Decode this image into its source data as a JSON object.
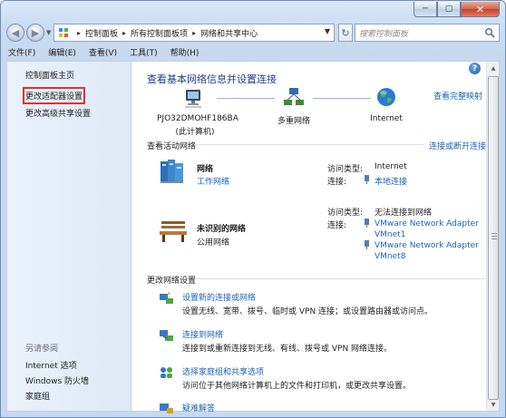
{
  "window": {
    "caption": {
      "minimize": "─",
      "maximize": "▢",
      "close": "✕"
    }
  },
  "nav": {
    "back": "◀",
    "forward": "▶",
    "breadcrumbs": [
      "控制面板",
      "所有控制面板项",
      "网络和共享中心"
    ],
    "search_placeholder": "搜索控制面板"
  },
  "menu": [
    "文件(F)",
    "编辑(E)",
    "查看(V)",
    "工具(T)",
    "帮助(H)"
  ],
  "sidebar": {
    "items": [
      "控制面板主页",
      "更改适配器设置",
      "更改高级共享设置"
    ],
    "see_also_heading": "另请参阅",
    "see_also": [
      "Internet 选项",
      "Windows 防火墙",
      "家庭组"
    ]
  },
  "main": {
    "title": "查看基本网络信息并设置连接",
    "full_map_link": "查看完整映射",
    "map": {
      "computer_name": "PJO32DMOHF186BA",
      "computer_sub": "(此计算机)",
      "middle": "多重网络",
      "internet": "Internet"
    },
    "active_heading": "查看活动网络",
    "connect_link": "连接或断开连接",
    "networks": [
      {
        "name": "网络",
        "type": "工作网络",
        "access_label": "访问类型:",
        "access_value": "Internet",
        "conn_label": "连接:",
        "conn_values": [
          "本地连接"
        ]
      },
      {
        "name": "未识别的网络",
        "type": "公用网络",
        "access_label": "访问类型:",
        "access_value": "无法连接到网络",
        "conn_label": "连接:",
        "conn_values": [
          "VMware Network Adapter VMnet1",
          "VMware Network Adapter VMnet8"
        ]
      }
    ],
    "change_heading": "更改网络设置",
    "tasks": [
      {
        "title": "设置新的连接或网络",
        "desc": "设置无线、宽带、拨号、临时或 VPN 连接；或设置路由器或访问点。"
      },
      {
        "title": "连接到网络",
        "desc": "连接到或重新连接到无线、有线、拨号或 VPN 网络连接。"
      },
      {
        "title": "选择家庭组和共享选项",
        "desc": "访问位于其他网络计算机上的文件和打印机，或更改共享设置。"
      },
      {
        "title": "疑难解答",
        "desc": ""
      }
    ]
  },
  "colors": {
    "link": "#1a64b6",
    "title": "#1e3e8c",
    "highlight": "#e0312b"
  }
}
